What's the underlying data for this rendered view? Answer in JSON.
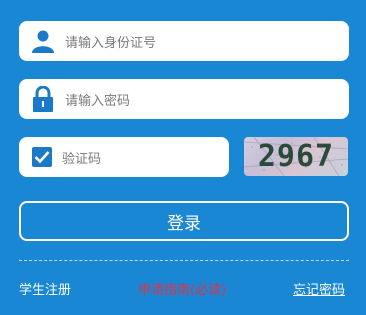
{
  "id_field": {
    "placeholder": "请输入身份证号",
    "icon": "user-icon"
  },
  "password_field": {
    "placeholder": "请输入密码",
    "icon": "lock-icon"
  },
  "captcha_field": {
    "placeholder": "验证码",
    "checked": true,
    "icon": "checkbox-checked-icon"
  },
  "captcha_image": {
    "text": "2967"
  },
  "login_button": {
    "label": "登录"
  },
  "links": {
    "register": "学生注册",
    "guide": "申请指南(必读)",
    "forgot": "忘记密码"
  },
  "colors": {
    "background": "#1a87d4",
    "icon": "#1a7ac8",
    "guide_link": "#e0314a"
  }
}
